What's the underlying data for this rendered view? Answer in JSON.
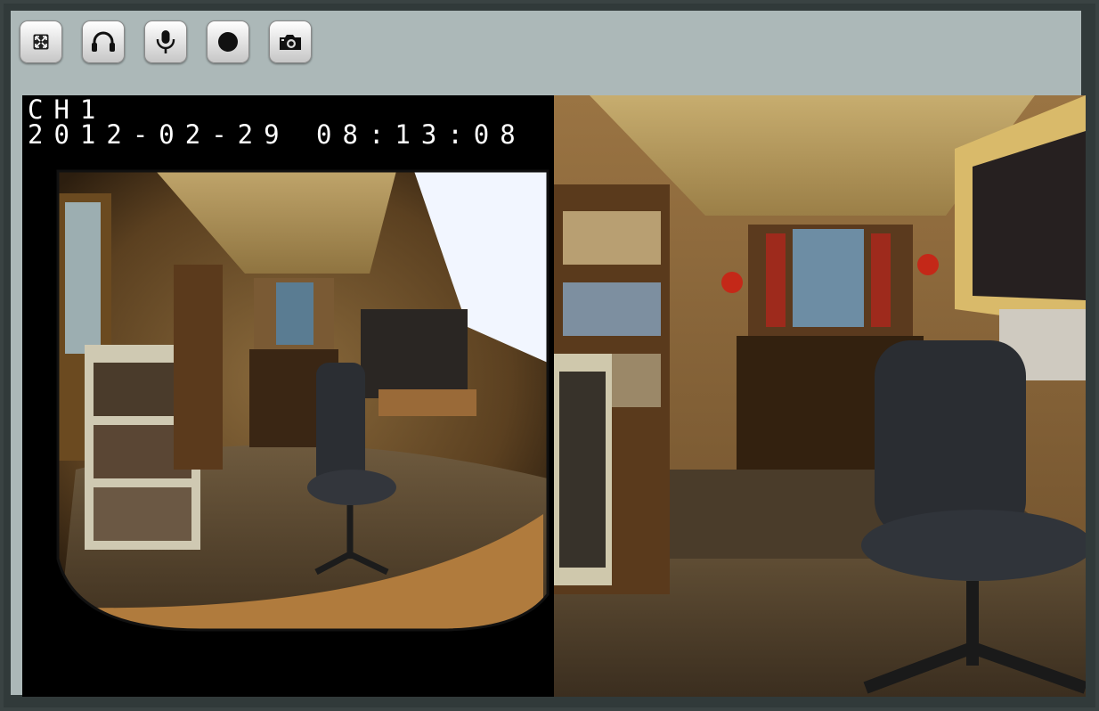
{
  "toolbar": {
    "buttons": [
      {
        "name": "fullscreen-button",
        "icon": "fullscreen-icon"
      },
      {
        "name": "audio-listen-button",
        "icon": "headphones-icon"
      },
      {
        "name": "talk-microphone-button",
        "icon": "microphone-icon"
      },
      {
        "name": "record-button",
        "icon": "record-icon"
      },
      {
        "name": "snapshot-button",
        "icon": "camera-icon"
      }
    ]
  },
  "video": {
    "left_view": {
      "channel": "CH1",
      "timestamp": "2012-02-29 08:13:08",
      "mode": "fisheye"
    },
    "right_view": {
      "mode": "dewarped"
    }
  },
  "colors": {
    "panel_bg": "#acb8b8",
    "frame": "#313a3a",
    "osd_text": "#ffffff"
  }
}
